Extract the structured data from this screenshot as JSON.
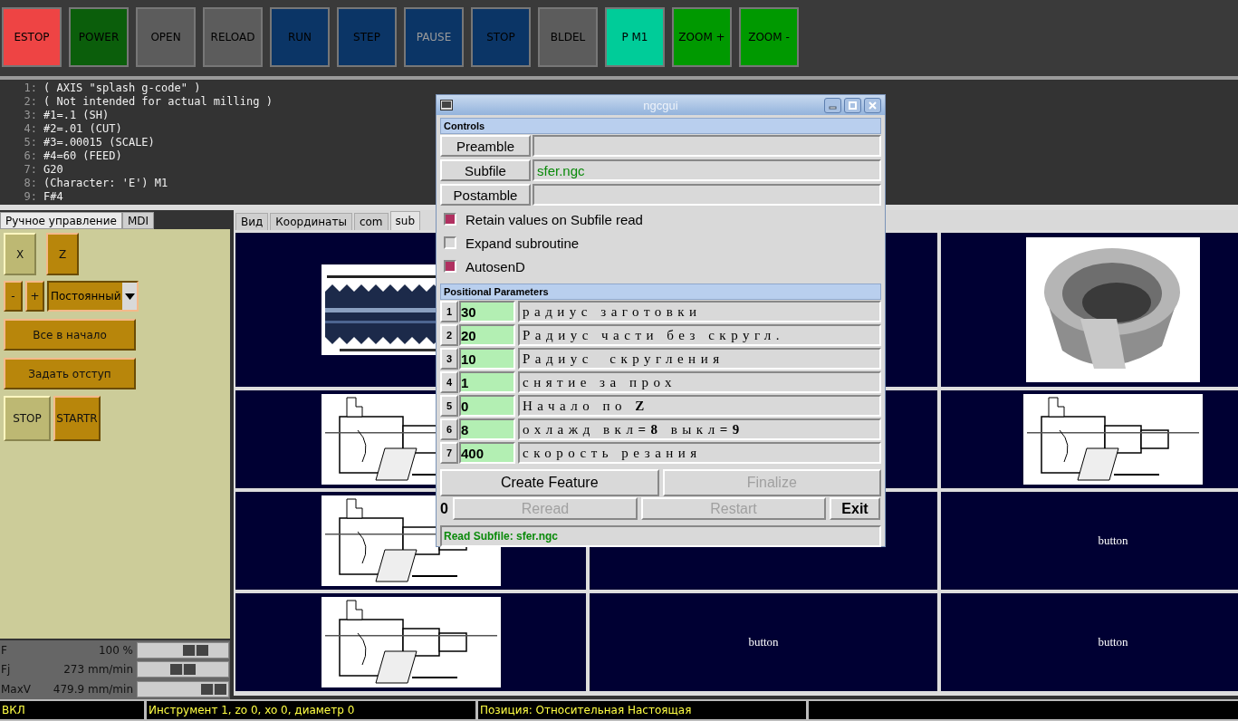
{
  "toolbar": {
    "buttons": [
      {
        "label": "ESTOP",
        "color": "#ee4444",
        "disabled": false
      },
      {
        "label": "POWER",
        "color": "#0b5e0b",
        "disabled": false
      },
      {
        "label": "OPEN",
        "color": "#5c5c5c",
        "disabled": false
      },
      {
        "label": "RELOAD",
        "color": "#5c5c5c",
        "disabled": false
      },
      {
        "label": "RUN",
        "color": "#0b3566",
        "disabled": false
      },
      {
        "label": "STEP",
        "color": "#0b3566",
        "disabled": false
      },
      {
        "label": "PAUSE",
        "color": "#0b3566",
        "disabled": true
      },
      {
        "label": "STOP",
        "color": "#0b3566",
        "disabled": false
      },
      {
        "label": "BLDEL",
        "color": "#5c5c5c",
        "disabled": false
      },
      {
        "label": "P M1",
        "color": "#00cc99",
        "disabled": false
      },
      {
        "label": "ZOOM +",
        "color": "#009900",
        "disabled": false
      },
      {
        "label": "ZOOM -",
        "color": "#009900",
        "disabled": false
      }
    ]
  },
  "editor": {
    "lines": [
      {
        "number": "1:",
        "text": "( AXIS \"splash g-code\" )"
      },
      {
        "number": "2:",
        "text": "( Not intended for actual milling )"
      },
      {
        "number": "3:",
        "text": "#1=.1 (SH)"
      },
      {
        "number": "4:",
        "text": "#2=.01 (CUT)"
      },
      {
        "number": "5:",
        "text": "#3=.00015 (SCALE)"
      },
      {
        "number": "6:",
        "text": "#4=60 (FEED)"
      },
      {
        "number": "7:",
        "text": "G20"
      },
      {
        "number": "8:",
        "text": "(Character: 'E') M1"
      },
      {
        "number": "9:",
        "text": "F#4"
      }
    ]
  },
  "manual_panel": {
    "tabs": [
      {
        "label": "Ручное управление",
        "selected": true
      },
      {
        "label": "MDI",
        "selected": false
      }
    ],
    "axes": [
      {
        "label": "X",
        "selected": true
      },
      {
        "label": "Z",
        "selected": false
      }
    ],
    "jog_buttons": [
      "-",
      "+"
    ],
    "jog_mode": {
      "value": "Постоянный"
    },
    "actions": [
      "Все в начало",
      "Задать отступ"
    ],
    "spindle_buttons": [
      {
        "label": "STOP",
        "selected": true
      },
      {
        "label": "STARTR",
        "selected": false
      }
    ]
  },
  "overrides": [
    {
      "label": "F",
      "reading": "100 %",
      "level": 0.7
    },
    {
      "label": "Fj",
      "reading": "273 mm/min",
      "level": 0.5
    },
    {
      "label": "MaxV",
      "reading": "479.9 mm/min",
      "level": 0.97
    }
  ],
  "view_tabs": [
    {
      "label": "Вид",
      "selected": false
    },
    {
      "label": "Координаты",
      "selected": false
    },
    {
      "label": "com",
      "selected": false
    },
    {
      "label": "sub",
      "selected": true
    }
  ],
  "cells": [
    {
      "kind": "picture"
    },
    {
      "kind": "empty"
    },
    {
      "kind": "picture"
    },
    {
      "kind": "picture"
    },
    {
      "kind": "empty"
    },
    {
      "kind": "picture"
    },
    {
      "kind": "picture"
    },
    {
      "kind": "empty"
    },
    {
      "kind": "button",
      "label": "button"
    },
    {
      "kind": "picture"
    },
    {
      "kind": "button",
      "label": "button"
    },
    {
      "kind": "button",
      "label": "button"
    }
  ],
  "ngcgui": {
    "title": "ngcgui",
    "controls_header": "Controls",
    "files": [
      {
        "button": "Preamble"
      },
      {
        "button": "Subfile",
        "value": "sfer.ngc"
      },
      {
        "button": "Postamble"
      }
    ],
    "options": [
      {
        "label": "Retain values on Subfile read",
        "checked": true
      },
      {
        "label": "Expand subroutine",
        "checked": false
      },
      {
        "label": "AutosenD",
        "checked": true
      }
    ],
    "params_header": "Positional Parameters",
    "params": [
      {
        "number": "1",
        "value": "30",
        "description": "радиус заготовки"
      },
      {
        "number": "2",
        "value": "20",
        "description": "Радиус части без скругл."
      },
      {
        "number": "3",
        "value": "10",
        "description": "Радиус  скругления"
      },
      {
        "number": "4",
        "value": "1",
        "description": "снятие за прох"
      },
      {
        "number": "5",
        "value": "0",
        "description": "Начало по **Z**"
      },
      {
        "number": "6",
        "value": "8",
        "description": "охлажд вкл**=8** выкл**=9**"
      },
      {
        "number": "7",
        "value": "400",
        "description": "скорость резания"
      }
    ],
    "actions": [
      {
        "label": "Create Feature",
        "disabled": false
      },
      {
        "label": "Finalize",
        "disabled": true
      }
    ],
    "counter": "0",
    "file_actions": [
      {
        "label": "Reread",
        "disabled": true
      },
      {
        "label": "Restart",
        "disabled": true
      },
      {
        "label": "Exit",
        "disabled": false
      }
    ],
    "status": "Read Subfile: sfer.ngc"
  },
  "status_bar": [
    "ВКЛ",
    "Инструмент 1, zo 0, xo 0, диаметр 0",
    "Позиция: Относительная Настоящая"
  ]
}
